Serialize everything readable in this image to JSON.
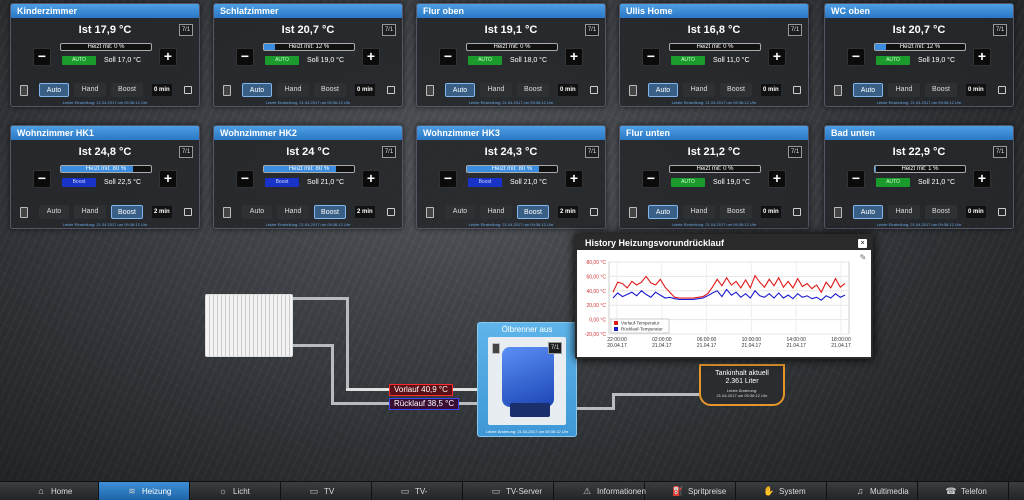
{
  "rooms": [
    {
      "name": "Kinderzimmer",
      "ist": "Ist 17,9 °C",
      "heizt": "Heizt mit: 0 %",
      "heizt_pct": 0,
      "mode": "AUTO",
      "soll": "Soll 17,0 °C",
      "min": "0 min",
      "active": "auto"
    },
    {
      "name": "Schlafzimmer",
      "ist": "Ist 20,7 °C",
      "heizt": "Heizt mit: 12 %",
      "heizt_pct": 12,
      "mode": "AUTO",
      "soll": "Soll 19,0 °C",
      "min": "0 min",
      "active": "auto"
    },
    {
      "name": "Flur oben",
      "ist": "Ist 19,1 °C",
      "heizt": "Heizt mit: 0 %",
      "heizt_pct": 0,
      "mode": "AUTO",
      "soll": "Soll 18,0 °C",
      "min": "0 min",
      "active": "auto"
    },
    {
      "name": "Ullis Home",
      "ist": "Ist 16,8 °C",
      "heizt": "Heizt mit: 0 %",
      "heizt_pct": 0,
      "mode": "AUTO",
      "soll": "Soll 11,0 °C",
      "min": "0 min",
      "active": "auto"
    },
    {
      "name": "WC oben",
      "ist": "Ist 20,7 °C",
      "heizt": "Heizt mit: 12 %",
      "heizt_pct": 12,
      "mode": "AUTO",
      "soll": "Soll 19,0 °C",
      "min": "0 min",
      "active": "auto"
    },
    {
      "name": "Wohnzimmer HK1",
      "ist": "Ist 24,8 °C",
      "heizt": "Heizt mit: 80 %",
      "heizt_pct": 80,
      "mode": "Boost",
      "soll": "Soll 22,5 °C",
      "min": "2 min",
      "active": "boost"
    },
    {
      "name": "Wohnzimmer HK2",
      "ist": "Ist 24 °C",
      "heizt": "Heizt mit: 80 %",
      "heizt_pct": 80,
      "mode": "Boost",
      "soll": "Soll 21,0 °C",
      "min": "2 min",
      "active": "boost"
    },
    {
      "name": "Wohnzimmer HK3",
      "ist": "Ist 24,3 °C",
      "heizt": "Heizt mit: 80 %",
      "heizt_pct": 80,
      "mode": "Boost",
      "soll": "Soll 21,0 °C",
      "min": "2 min",
      "active": "boost"
    },
    {
      "name": "Flur unten",
      "ist": "Ist 21,2 °C",
      "heizt": "Heizt mit: 0 %",
      "heizt_pct": 0,
      "mode": "AUTO",
      "soll": "Soll 19,0 °C",
      "min": "0 min",
      "active": "auto"
    },
    {
      "name": "Bad unten",
      "ist": "Ist 22,9 °C",
      "heizt": "Heizt mit: 1 %",
      "heizt_pct": 1,
      "mode": "AUTO",
      "soll": "Soll 21,0 °C",
      "min": "0 min",
      "active": "auto"
    }
  ],
  "tile_buttons": {
    "auto": "Auto",
    "hand": "Hand",
    "boost": "Boost",
    "calendar": "7/1",
    "minus": "−",
    "plus": "+"
  },
  "tile_footer": "Letzte Einstellung: 21.04.2017 um 09:36:12 Uhr",
  "vorlauf": "Vorlauf 40,9 °C",
  "ruecklauf": "Rücklauf 38,5 °C",
  "burner": {
    "title": "Ölbrenner aus",
    "footer": "Letzte Änderung: 21.04.2017 um 09:36:12 Uhr"
  },
  "tank": {
    "line1": "Tankinhalt aktuell",
    "line2": "2.361 Liter",
    "line3": "Letzte Änderung:",
    "line4": "21.04.2017 um 09:36:12 Uhr"
  },
  "history": {
    "title": "History Heizungsvorundrücklauf",
    "close": "×",
    "edit_icon": "pencil-icon"
  },
  "chart_data": {
    "type": "line",
    "ylim": [
      -20,
      80
    ],
    "yticks": [
      "80,00 °C",
      "60,00 °C",
      "40,00 °C",
      "20,00 °C",
      "0,00 °C",
      "-20,00 °C"
    ],
    "ytick_values": [
      80,
      60,
      40,
      20,
      0,
      -20
    ],
    "xticks": [
      [
        "22:00:00",
        "20.04.17"
      ],
      [
        "02:00:00",
        "21.04.17"
      ],
      [
        "06:00:00",
        "21.04.17"
      ],
      [
        "10:00:00",
        "21.04.17"
      ],
      [
        "14:00:00",
        "21.04.17"
      ],
      [
        "18:00:00",
        "21.04.17"
      ]
    ],
    "series": [
      {
        "name": "Vorlauf-Temperatur",
        "color": "#e01818",
        "values": [
          38,
          52,
          50,
          44,
          53,
          48,
          52,
          60,
          51,
          48,
          56,
          45,
          38,
          31,
          30,
          30,
          30,
          30,
          31,
          32,
          36,
          45,
          56,
          47,
          58,
          48,
          53,
          44,
          55,
          44,
          61,
          52,
          45,
          56,
          47,
          58,
          45,
          53,
          44,
          57,
          46,
          50,
          43,
          48,
          38,
          52,
          44,
          57,
          45,
          50
        ]
      },
      {
        "name": "Rücklauf-Temperatur",
        "color": "#1a1ad0",
        "values": [
          30,
          37,
          32,
          35,
          38,
          33,
          40,
          35,
          31,
          38,
          34,
          30,
          31,
          29,
          28,
          28,
          28,
          28,
          29,
          30,
          33,
          37,
          40,
          32,
          42,
          34,
          38,
          31,
          36,
          30,
          40,
          33,
          31,
          36,
          30,
          37,
          30,
          34,
          29,
          36,
          31,
          33,
          29,
          31,
          27,
          33,
          30,
          36,
          31,
          34
        ]
      }
    ],
    "legend": "bottom-left",
    "grid": true
  },
  "nav": [
    {
      "label": "Home",
      "icon": "home-icon",
      "glyph": "⌂",
      "active": false
    },
    {
      "label": "Heizung",
      "icon": "heating-icon",
      "glyph": "≋",
      "active": true
    },
    {
      "label": "Licht",
      "icon": "light-icon",
      "glyph": "☼",
      "active": false
    },
    {
      "label": "TV",
      "icon": "tv-icon",
      "glyph": "▭",
      "active": false
    },
    {
      "label": "TV-Programm",
      "icon": "tv-guide-icon",
      "glyph": "▭",
      "active": false
    },
    {
      "label": "TV-Server",
      "icon": "server-icon",
      "glyph": "▭",
      "active": false
    },
    {
      "label": "Informationen",
      "icon": "info-icon",
      "glyph": "⚠",
      "active": false
    },
    {
      "label": "Spritpreise",
      "icon": "fuel-icon",
      "glyph": "⛽",
      "active": false
    },
    {
      "label": "System",
      "icon": "system-icon",
      "glyph": "✋",
      "active": false
    },
    {
      "label": "Multimedia",
      "icon": "multimedia-icon",
      "glyph": "♫",
      "active": false
    },
    {
      "label": "Telefon",
      "icon": "phone-icon",
      "glyph": "☎",
      "active": false
    }
  ]
}
